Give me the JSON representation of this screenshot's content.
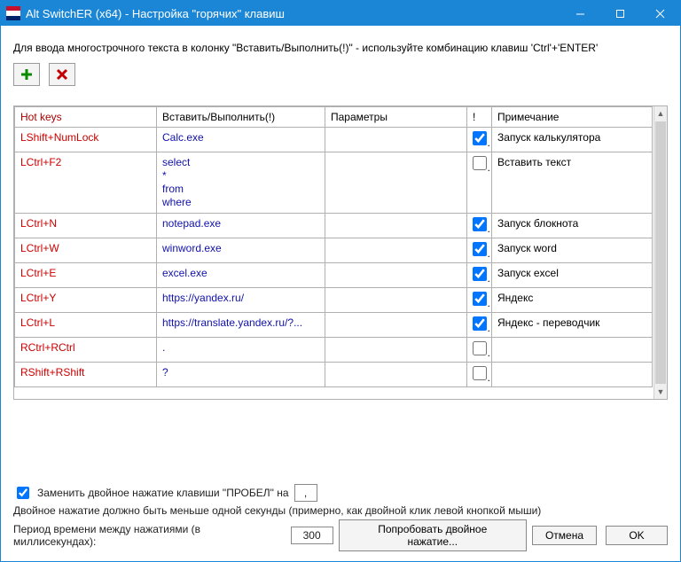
{
  "window": {
    "title": "Alt SwitchER (x64) - Настройка \"горячих\" клавиш"
  },
  "hint": "Для ввода многострочного текста в колонку \"Вставить/Выполнить(!)\" - используйте комбинацию клавиш 'Ctrl'+'ENTER'",
  "columns": {
    "hotkeys": "Hot keys",
    "insert": "Вставить/Выполнить(!)",
    "params": "Параметры",
    "flag": "!",
    "note": "Примечание"
  },
  "rows": [
    {
      "hotkey": "LShift+NumLock",
      "insert": "Calc.exe",
      "params": "",
      "flag": true,
      "note": "Запуск калькулятора"
    },
    {
      "hotkey": "LCtrl+F2",
      "insert": "select\n*\nfrom\nwhere",
      "params": "",
      "flag": false,
      "note": "Вставить текст",
      "multiline": true
    },
    {
      "hotkey": "LCtrl+N",
      "insert": "notepad.exe",
      "params": "",
      "flag": true,
      "note": "Запуск блокнота"
    },
    {
      "hotkey": "LCtrl+W",
      "insert": "winword.exe",
      "params": "",
      "flag": true,
      "note": "Запуск word"
    },
    {
      "hotkey": "LCtrl+E",
      "insert": "excel.exe",
      "params": "",
      "flag": true,
      "note": "Запуск excel"
    },
    {
      "hotkey": "LCtrl+Y",
      "insert": "https://yandex.ru/",
      "params": "",
      "flag": true,
      "note": "Яндекс"
    },
    {
      "hotkey": "LCtrl+L",
      "insert": "https://translate.yandex.ru/?...",
      "params": "",
      "flag": true,
      "note": "Яндекс - переводчик"
    },
    {
      "hotkey": "RCtrl+RCtrl",
      "insert": ".",
      "params": "",
      "flag": false,
      "note": ""
    },
    {
      "hotkey": "RShift+RShift",
      "insert": "?",
      "params": "",
      "flag": false,
      "note": ""
    }
  ],
  "footer": {
    "replace_dbl_space_checked": true,
    "replace_dbl_space_label": "Заменить двойное нажатие клавиши \"ПРОБЕЛ\" на",
    "replace_dbl_space_value": ",",
    "dbl_hint": "Двойное нажатие должно быть меньше одной секунды (примерно, как двойной клик левой кнопкой мыши)",
    "interval_label": "Период времени между нажатиями (в миллисекундах):",
    "interval_value": "300",
    "try_label": "Попробовать двойное нажатие...",
    "cancel_label": "Отмена",
    "ok_label": "OK"
  }
}
